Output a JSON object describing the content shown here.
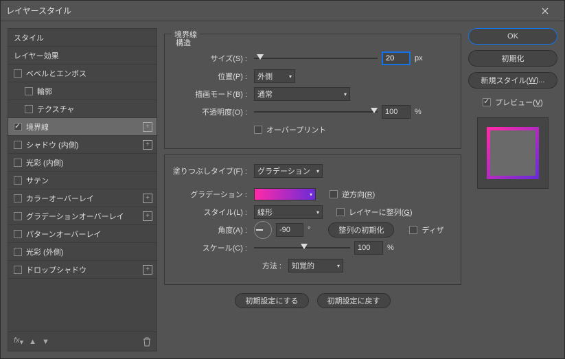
{
  "window": {
    "title": "レイヤースタイル"
  },
  "sidebar": {
    "header": "スタイル",
    "items": [
      {
        "label": "レイヤー効果",
        "checkbox": false,
        "checked": false,
        "indent": false,
        "add": false
      },
      {
        "label": "ベベルとエンボス",
        "checkbox": true,
        "checked": false,
        "indent": false,
        "add": false
      },
      {
        "label": "輪郭",
        "checkbox": true,
        "checked": false,
        "indent": true,
        "add": false
      },
      {
        "label": "テクスチャ",
        "checkbox": true,
        "checked": false,
        "indent": true,
        "add": false
      },
      {
        "label": "境界線",
        "checkbox": true,
        "checked": true,
        "indent": false,
        "add": true,
        "selected": true
      },
      {
        "label": "シャドウ (内側)",
        "checkbox": true,
        "checked": false,
        "indent": false,
        "add": true
      },
      {
        "label": "光彩 (内側)",
        "checkbox": true,
        "checked": false,
        "indent": false,
        "add": false
      },
      {
        "label": "サテン",
        "checkbox": true,
        "checked": false,
        "indent": false,
        "add": false
      },
      {
        "label": "カラーオーバーレイ",
        "checkbox": true,
        "checked": false,
        "indent": false,
        "add": true
      },
      {
        "label": "グラデーションオーバーレイ",
        "checkbox": true,
        "checked": false,
        "indent": false,
        "add": true
      },
      {
        "label": "パターンオーバーレイ",
        "checkbox": true,
        "checked": false,
        "indent": false,
        "add": false
      },
      {
        "label": "光彩 (外側)",
        "checkbox": true,
        "checked": false,
        "indent": false,
        "add": false
      },
      {
        "label": "ドロップシャドウ",
        "checkbox": true,
        "checked": false,
        "indent": false,
        "add": true
      }
    ]
  },
  "stroke": {
    "section_title": "境界線",
    "structure_label": "構造",
    "size_label": "サイズ(S) :",
    "size_value": "20",
    "size_unit": "px",
    "position_label": "位置(P) :",
    "position_value": "外側",
    "blendmode_label": "描画モード(B) :",
    "blendmode_value": "通常",
    "opacity_label": "不透明度(O) :",
    "opacity_value": "100",
    "opacity_unit": "%",
    "overprint_label": "オーバープリント",
    "filltype_label": "塗りつぶしタイプ(F) :",
    "filltype_value": "グラデーション",
    "gradient_label": "グラデーション :",
    "reverse_label": "逆方向(R)",
    "style_label": "スタイル(L) :",
    "style_value": "線形",
    "align_label": "レイヤーに整列(G)",
    "angle_label": "角度(A) :",
    "angle_value": "-90",
    "angle_unit": "°",
    "reset_align_btn": "整列の初期化",
    "dither_label": "ディザ",
    "scale_label": "スケール(C) :",
    "scale_value": "100",
    "scale_unit": "%",
    "method_label": "方法 :",
    "method_value": "知覚的",
    "make_default_btn": "初期設定にする",
    "reset_default_btn": "初期設定に戻す"
  },
  "right": {
    "ok": "OK",
    "reset": "初期化",
    "new_style": "新規スタイル(W)...",
    "preview": "プレビュー(V)"
  }
}
